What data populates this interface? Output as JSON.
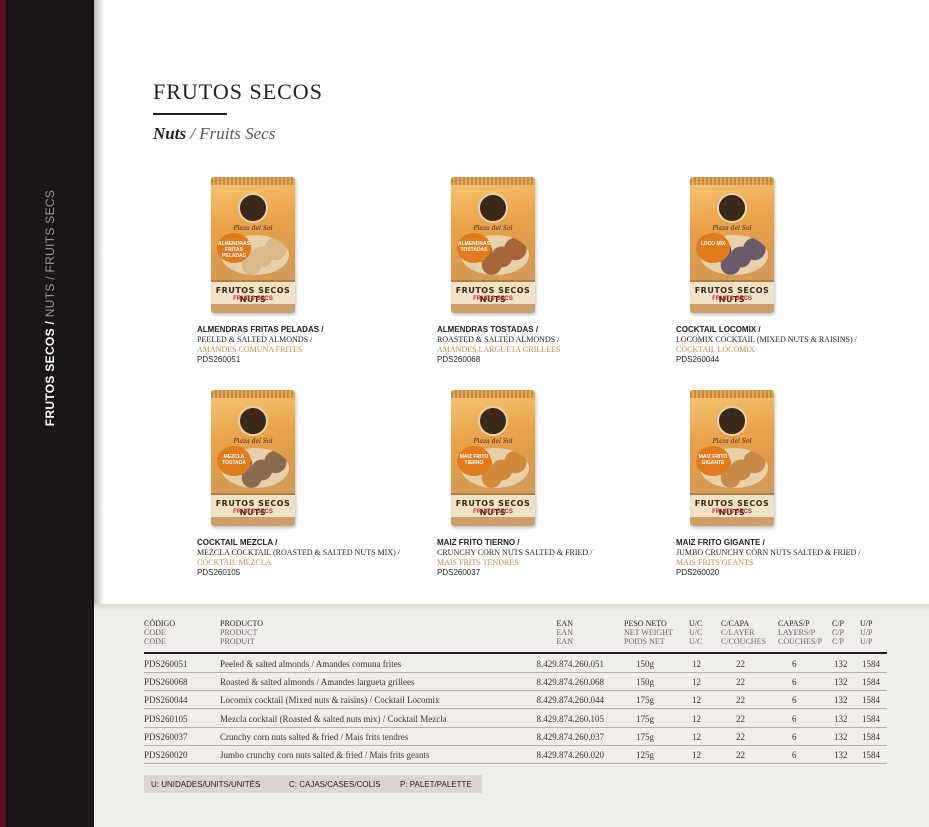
{
  "spine": {
    "primary": "FRUTOS SECOS /",
    "secondary": " NUTS / FRUITS SECS"
  },
  "header": {
    "title": "FRUTOS SECOS",
    "subtitle_main": "Nuts",
    "subtitle_rest": " / Fruits Secs"
  },
  "bag": {
    "brand": "Plaza del Sol",
    "band_main": "FRUTOS SECOS NUTS",
    "band_sub": "FRUITS SECS"
  },
  "products": [
    {
      "badge": "ALMENDRAS FRITAS PELADAS",
      "name_es": "ALMENDRAS FRITAS PELADAS /",
      "name_en": "PEELED & SALTED ALMONDS /",
      "name_fr": "AMANDES COMUNA FRITES",
      "code": "PDS260051",
      "nut": "#d9b88a"
    },
    {
      "badge": "ALMENDRAS TOSTADAS",
      "name_es": "ALMENDRAS TOSTADAS /",
      "name_en": "ROASTED & SALTED ALMONDS /",
      "name_fr": "AMANDES LARGUETA GRILLEES",
      "code": "PDS260068",
      "nut": "#a8643a"
    },
    {
      "badge": "LOCO MIX",
      "name_es": "COCKTAIL LOCOMIX /",
      "name_en": "LOCOMIX COCKTAIL (MIXED NUTS & RAISINS) /",
      "name_fr": "COCKTAIL LOCOMIX",
      "code": "PDS260044",
      "nut": "#6a5a6a"
    },
    {
      "badge": "MEZCLA TOSTADA",
      "name_es": "COCKTAIL MEZCLA /",
      "name_en": "MEZCLA COCKTAIL (ROASTED & SALTED NUTS MIX) /",
      "name_fr": "COCKTAIL MEZCLA",
      "code": "PDS260105",
      "nut": "#8a6a50"
    },
    {
      "badge": "MAIZ FRITO TIERNO",
      "name_es": "MAIZ FRITO TIERNO /",
      "name_en": "CRUNCHY CORN NUTS SALTED & FRIED /",
      "name_fr": "MAIS FRITS TENDRES",
      "code": "PDS260037",
      "nut": "#d08a3a"
    },
    {
      "badge": "MAIZ FRITO GIGANTE",
      "name_es": "MAIZ FRITO GIGANTE /",
      "name_en": "JUMBO CRUNCHY CORN NUTS SALTED & FRIED /",
      "name_fr": "MAIS FRITS GEANTS",
      "code": "PDS260020",
      "nut": "#c88a48"
    }
  ],
  "table": {
    "headers": {
      "code": [
        "CÓDIGO",
        "CODE",
        "CODE"
      ],
      "product": [
        "PRODUCTO",
        "PRODUCT",
        "PRODUIT"
      ],
      "ean": [
        "EAN",
        "EAN",
        "EAN"
      ],
      "weight": [
        "PESO NETO",
        "NET WEIGHT",
        "POIDS NET"
      ],
      "uc": [
        "U/C",
        "U/C",
        "U/C"
      ],
      "ccapa": [
        "C/CAPA",
        "C/LAYER",
        "C/COUCHES"
      ],
      "capas": [
        "CAPAS/P",
        "LAYERS/P",
        "COUCHES/P"
      ],
      "cp": [
        "C/P",
        "C/P",
        "C/P"
      ],
      "up": [
        "U/P",
        "U/P",
        "U/P"
      ]
    },
    "rows": [
      {
        "code": "PDS260051",
        "product": "Peeled & salted almonds / Amandes comuna frites",
        "ean": "8.429.874.260.051",
        "weight": "150g",
        "uc": "12",
        "ccapa": "22",
        "capas": "6",
        "cp": "132",
        "up": "1584"
      },
      {
        "code": "PDS260068",
        "product": "Roasted & salted almonds / Amandes largueta grillees",
        "ean": "8.429.874.260.068",
        "weight": "150g",
        "uc": "12",
        "ccapa": "22",
        "capas": "6",
        "cp": "132",
        "up": "1584"
      },
      {
        "code": "PDS260044",
        "product": "Locomix cocktail (Mixed nuts & raisins) / Cocktail Locomix",
        "ean": "8.429.874.260.044",
        "weight": "175g",
        "uc": "12",
        "ccapa": "22",
        "capas": "6",
        "cp": "132",
        "up": "1584"
      },
      {
        "code": "PDS260105",
        "product": "Mezcla cocktail (Roasted & salted nuts mix) / Cocktail Mezcla",
        "ean": "8.429.874.260.105",
        "weight": "175g",
        "uc": "12",
        "ccapa": "22",
        "capas": "6",
        "cp": "132",
        "up": "1584"
      },
      {
        "code": "PDS260037",
        "product": "Crunchy corn nuts salted & fried / Mais frits tendres",
        "ean": "8.429.874.260.037",
        "weight": "175g",
        "uc": "12",
        "ccapa": "22",
        "capas": "6",
        "cp": "132",
        "up": "1584"
      },
      {
        "code": "PDS260020",
        "product": "Jumbo crunchy corn nuts salted & fried / Mais frits geants",
        "ean": "8.429.874.260.020",
        "weight": "125g",
        "uc": "12",
        "ccapa": "22",
        "capas": "6",
        "cp": "132",
        "up": "1584"
      }
    ]
  },
  "legend": {
    "u": "U: UNIDADES/UNITS/UNITÉS",
    "c": "C: CAJAS/CASES/COLIS",
    "p": "P: PALET/PALETTE"
  }
}
